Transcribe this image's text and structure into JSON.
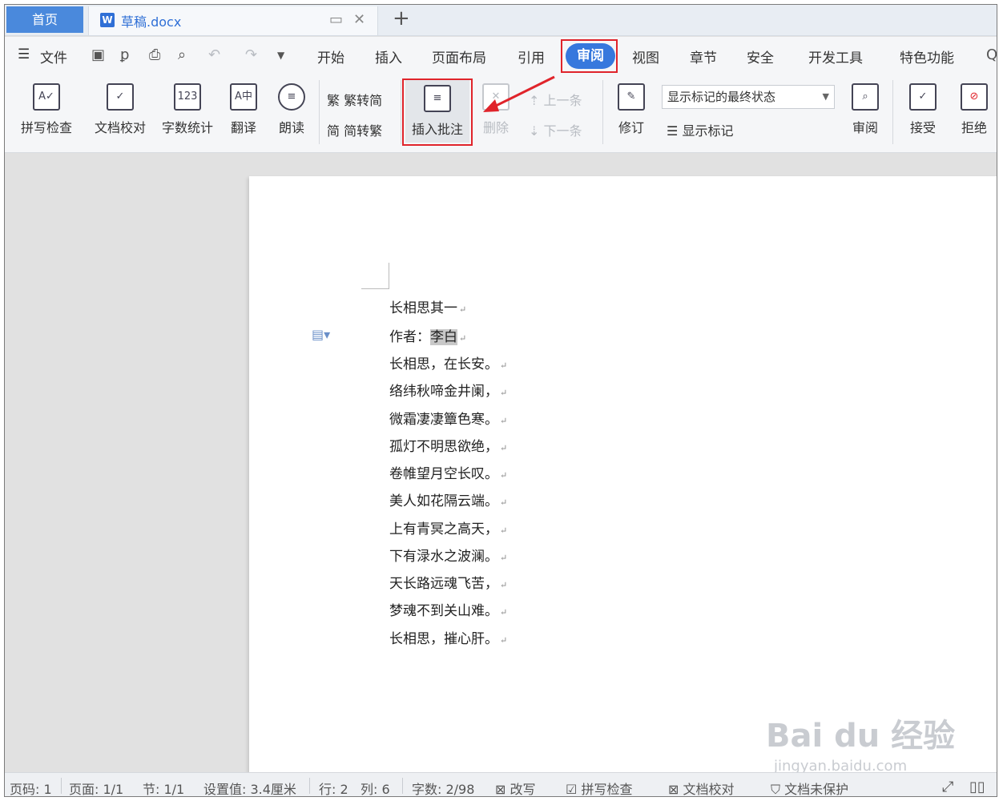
{
  "tabs": {
    "home": "首页",
    "doc": "草稿.docx",
    "add": "+"
  },
  "menu": {
    "file": "文件",
    "items": [
      "开始",
      "插入",
      "页面布局",
      "引用",
      "审阅",
      "视图",
      "章节",
      "安全",
      "开发工具",
      "特色功能"
    ],
    "active": "审阅"
  },
  "ribbon": {
    "spell_check": "拼写检查",
    "doc_proof": "文档校对",
    "word_count": "字数统计",
    "translate": "翻译",
    "read_aloud": "朗读",
    "trad_to_simp": "繁转简",
    "simp_to_trad": "简转繁",
    "insert_comment": "插入批注",
    "delete": "删除",
    "prev": "上一条",
    "next": "下一条",
    "revise": "修订",
    "display_state": "显示标记的最终状态",
    "show_marks": "显示标记",
    "review": "审阅",
    "accept": "接受",
    "reject": "拒绝"
  },
  "document": {
    "lines": [
      "长相思其一",
      "作者：",
      "长相思，在长安。",
      "络纬秋啼金井阑，",
      "微霜凄凄簟色寒。",
      "孤灯不明思欲绝，",
      "卷帷望月空长叹。",
      "美人如花隔云端。",
      "上有青冥之高天，",
      "下有渌水之波澜。",
      "天长路远魂飞苦，",
      "梦魂不到关山难。",
      "长相思，摧心肝。"
    ],
    "author_name": "李白"
  },
  "status": {
    "page_code": "页码: 1",
    "page": "页面: 1/1",
    "section": "节: 1/1",
    "setting": "设置值: 3.4厘米",
    "row": "行: 2",
    "col": "列: 6",
    "word_count": "字数: 2/98",
    "overwrite": "改写",
    "spell_check": "拼写检查",
    "doc_proof": "文档校对",
    "protect": "文档未保护"
  },
  "watermark": {
    "main": "Bai du 经验",
    "sub": "jingyan.baidu.com"
  },
  "colors": {
    "accent": "#3778dd",
    "highlight_red": "#e0242b"
  }
}
